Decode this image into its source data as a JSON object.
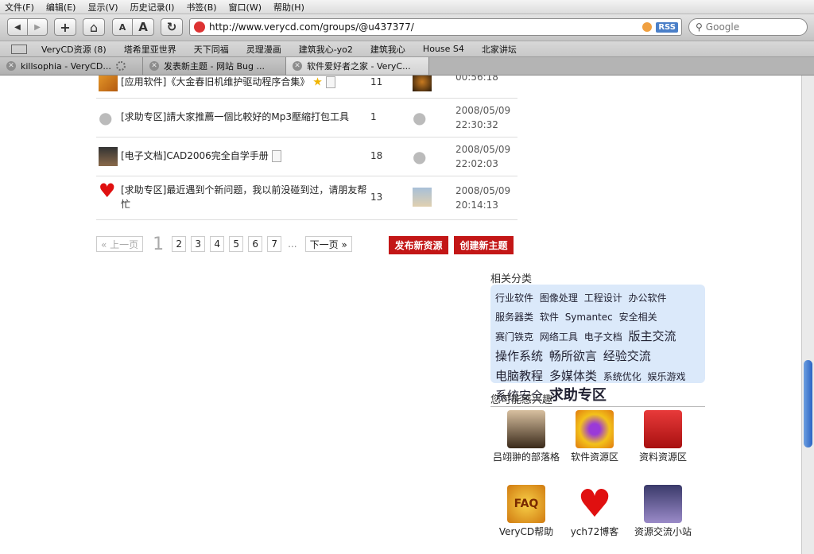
{
  "menu": [
    "文件(F)",
    "编辑(E)",
    "显示(V)",
    "历史记录(I)",
    "书签(B)",
    "窗口(W)",
    "帮助(H)"
  ],
  "toolbar": {
    "back": "◀",
    "forward": "▶",
    "add": "+",
    "home": "⌂",
    "font_small": "A",
    "font_large": "A",
    "refresh": "↻",
    "url": "http://www.verycd.com/groups/@u437377/",
    "rss": "RSS",
    "search_placeholder": "Google"
  },
  "bookmarks": [
    "VeryCD资源 (8)",
    "塔希里亚世界",
    "天下同福",
    "灵理漫画",
    "建筑我心-yo2",
    "建筑我心",
    "House S4",
    "北家讲坛"
  ],
  "tabs": [
    {
      "label": "killsophia - VeryCD..."
    },
    {
      "label": "发表新主题 - 网站 Bug ..."
    },
    {
      "label": "软件爱好者之家 - VeryC..."
    }
  ],
  "topics": [
    {
      "title": "[应用软件]《大金春旧机维护驱动程序合集》",
      "count": "11",
      "time_date": "",
      "time_clock": "00:56:18"
    },
    {
      "title": "[求助专区]請大家推薦一個比較好的Mp3壓縮打包工具",
      "count": "1",
      "time_date": "2008/05/09",
      "time_clock": "22:30:32"
    },
    {
      "title": "[电子文档]CAD2006完全自学手册",
      "count": "18",
      "time_date": "2008/05/09",
      "time_clock": "22:02:03"
    },
    {
      "title": "[求助专区]最近遇到个新问题，我以前没碰到过，请朋友帮忙",
      "count": "13",
      "time_date": "2008/05/09",
      "time_clock": "20:14:13"
    }
  ],
  "pager": {
    "prev": "« 上一页",
    "current": "1",
    "pages": [
      "2",
      "3",
      "4",
      "5",
      "6",
      "7"
    ],
    "ellipsis": "...",
    "next": "下一页 »"
  },
  "actions": {
    "publish": "发布新资源",
    "create": "创建新主题"
  },
  "related": {
    "title": "相关分类",
    "tags": [
      {
        "text": "行业软件",
        "size": 1
      },
      {
        "text": "图像处理",
        "size": 1
      },
      {
        "text": "工程设计",
        "size": 1
      },
      {
        "text": "办公软件",
        "size": 1
      },
      {
        "text": "服务器类",
        "size": 1
      },
      {
        "text": "软件",
        "size": 1
      },
      {
        "text": "Symantec",
        "size": 1
      },
      {
        "text": "安全相关",
        "size": 1
      },
      {
        "text": "赛门铁克",
        "size": 1
      },
      {
        "text": "网络工具",
        "size": 1
      },
      {
        "text": "电子文档",
        "size": 1
      },
      {
        "text": "版主交流",
        "size": 2
      },
      {
        "text": "操作系统",
        "size": 2
      },
      {
        "text": "畅所欲言",
        "size": 2
      },
      {
        "text": "经验交流",
        "size": 2
      },
      {
        "text": "电脑教程",
        "size": 2
      },
      {
        "text": "多媒体类",
        "size": 2
      },
      {
        "text": "系统优化",
        "size": 1
      },
      {
        "text": "娱乐游戏",
        "size": 1
      },
      {
        "text": "系统安全",
        "size": 2
      },
      {
        "text": "求助专区",
        "size": 3
      }
    ]
  },
  "interests": {
    "title": "您可能感兴趣",
    "items": [
      {
        "label": "吕翊翀的部落格"
      },
      {
        "label": "软件资源区"
      },
      {
        "label": "资料资源区"
      },
      {
        "label": "VeryCD帮助"
      },
      {
        "label": "ych72博客"
      },
      {
        "label": "资源交流小站"
      }
    ]
  },
  "colors": {
    "accent_red": "#c31616",
    "tag_cloud_bg": "#dbe9fa",
    "scroll_thumb": "#2b64c4"
  }
}
